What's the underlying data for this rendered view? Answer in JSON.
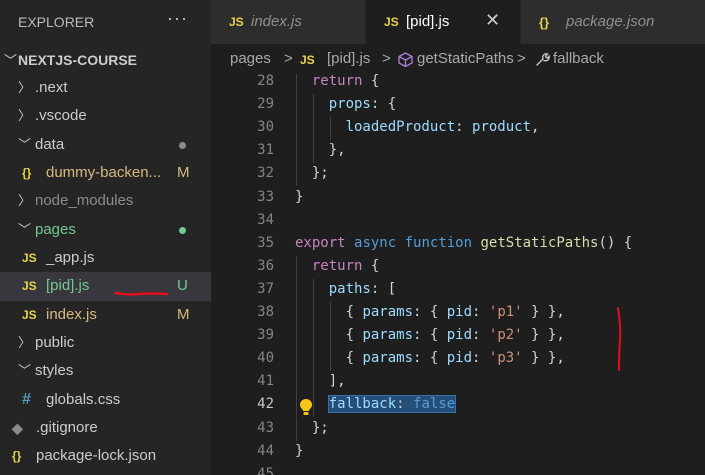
{
  "explorer": {
    "title": "EXPLORER",
    "more": "···",
    "root": "NEXTJS-COURSE",
    "items": [
      {
        "type": "folder",
        "label": ".next",
        "open": false,
        "depth": 0,
        "status": ""
      },
      {
        "type": "folder",
        "label": ".vscode",
        "open": false,
        "depth": 0,
        "status": ""
      },
      {
        "type": "folder",
        "label": "data",
        "open": true,
        "depth": 0,
        "status": "dot",
        "status_color": "#8c8c8c"
      },
      {
        "type": "file",
        "icon": "{}",
        "label": "dummy-backen...",
        "depth": 1,
        "status": "M",
        "status_color": "#d7ba7d",
        "label_color": "#d7ba7d"
      },
      {
        "type": "folder",
        "label": "node_modules",
        "open": false,
        "depth": 0,
        "status": "",
        "label_color": "#8c8c8c"
      },
      {
        "type": "folder",
        "label": "pages",
        "open": true,
        "depth": 0,
        "status": "dot",
        "status_color": "#73c991",
        "label_color": "#73c991"
      },
      {
        "type": "file",
        "icon": "JS",
        "label": "_app.js",
        "depth": 1,
        "status": ""
      },
      {
        "type": "file",
        "icon": "JS",
        "label": "[pid].js",
        "depth": 1,
        "status": "U",
        "status_color": "#73c991",
        "label_color": "#73c991",
        "selected": true
      },
      {
        "type": "file",
        "icon": "JS",
        "label": "index.js",
        "depth": 1,
        "status": "M",
        "status_color": "#d7ba7d",
        "label_color": "#d7ba7d"
      },
      {
        "type": "folder",
        "label": "public",
        "open": false,
        "depth": 0,
        "status": ""
      },
      {
        "type": "folder",
        "label": "styles",
        "open": true,
        "depth": 0,
        "status": ""
      },
      {
        "type": "file",
        "icon": "#",
        "label": "globals.css",
        "depth": 1,
        "status": ""
      },
      {
        "type": "file",
        "icon": "◆",
        "label": ".gitignore",
        "depth": 0,
        "status": ""
      },
      {
        "type": "file",
        "icon": "{}",
        "label": "package-lock.json",
        "depth": 0,
        "status": ""
      }
    ]
  },
  "tabs": [
    {
      "icon": "JS",
      "label": "index.js",
      "active": false
    },
    {
      "icon": "JS",
      "label": "[pid].js",
      "active": true,
      "close": "✕"
    },
    {
      "icon": "{}",
      "label": "package.json",
      "active": false
    }
  ],
  "breadcrumb": [
    "pages",
    ">",
    "JS",
    "[pid].js",
    ">",
    "getStaticPaths",
    ">",
    "fallback"
  ],
  "editor": {
    "current_line": 42,
    "lines": [
      {
        "n": "28",
        "indent": 1,
        "tokens": [
          [
            "kw",
            "return"
          ],
          [
            "pun",
            " {"
          ]
        ]
      },
      {
        "n": "29",
        "indent": 2,
        "tokens": [
          [
            "prop",
            "props"
          ],
          [
            "pun",
            ": {"
          ]
        ]
      },
      {
        "n": "30",
        "indent": 3,
        "tokens": [
          [
            "prop",
            "loadedProduct"
          ],
          [
            "pun",
            ": "
          ],
          [
            "prop",
            "product"
          ],
          [
            "pun",
            ","
          ]
        ]
      },
      {
        "n": "31",
        "indent": 2,
        "tokens": [
          [
            "pun",
            "},"
          ]
        ]
      },
      {
        "n": "32",
        "indent": 1,
        "tokens": [
          [
            "pun",
            "};"
          ]
        ]
      },
      {
        "n": "33",
        "indent": 0,
        "tokens": [
          [
            "pun",
            "}"
          ]
        ]
      },
      {
        "n": "34",
        "indent": 0,
        "tokens": []
      },
      {
        "n": "35",
        "indent": 0,
        "tokens": [
          [
            "kw",
            "export"
          ],
          [
            "pun",
            " "
          ],
          [
            "kb",
            "async"
          ],
          [
            "pun",
            " "
          ],
          [
            "kb",
            "function"
          ],
          [
            "pun",
            " "
          ],
          [
            "fn",
            "getStaticPaths"
          ],
          [
            "pun",
            "() {"
          ]
        ]
      },
      {
        "n": "36",
        "indent": 1,
        "tokens": [
          [
            "kw",
            "return"
          ],
          [
            "pun",
            " {"
          ]
        ]
      },
      {
        "n": "37",
        "indent": 2,
        "tokens": [
          [
            "prop",
            "paths"
          ],
          [
            "pun",
            ": ["
          ]
        ]
      },
      {
        "n": "38",
        "indent": 3,
        "tokens": [
          [
            "pun",
            "{ "
          ],
          [
            "prop",
            "params"
          ],
          [
            "pun",
            ": { "
          ],
          [
            "prop",
            "pid"
          ],
          [
            "pun",
            ": "
          ],
          [
            "str",
            "'p1'"
          ],
          [
            "pun",
            " } },"
          ]
        ]
      },
      {
        "n": "39",
        "indent": 3,
        "tokens": [
          [
            "pun",
            "{ "
          ],
          [
            "prop",
            "params"
          ],
          [
            "pun",
            ": { "
          ],
          [
            "prop",
            "pid"
          ],
          [
            "pun",
            ": "
          ],
          [
            "str",
            "'p2'"
          ],
          [
            "pun",
            " } },"
          ]
        ]
      },
      {
        "n": "40",
        "indent": 3,
        "tokens": [
          [
            "pun",
            "{ "
          ],
          [
            "prop",
            "params"
          ],
          [
            "pun",
            ": { "
          ],
          [
            "prop",
            "pid"
          ],
          [
            "pun",
            ": "
          ],
          [
            "str",
            "'p3'"
          ],
          [
            "pun",
            " } },"
          ]
        ]
      },
      {
        "n": "41",
        "indent": 2,
        "tokens": [
          [
            "pun",
            "],"
          ]
        ]
      },
      {
        "n": "42",
        "indent": 2,
        "tokens": [
          [
            "prop",
            "fallback"
          ],
          [
            "pun",
            ": "
          ],
          [
            "kb",
            "false"
          ]
        ],
        "selected": true
      },
      {
        "n": "43",
        "indent": 1,
        "tokens": [
          [
            "pun",
            "};"
          ]
        ]
      },
      {
        "n": "44",
        "indent": 0,
        "tokens": [
          [
            "pun",
            "}"
          ]
        ]
      },
      {
        "n": "45",
        "indent": 0,
        "tokens": []
      }
    ]
  },
  "annotation_color": "#e0101e",
  "bulb_color": "#f5c518"
}
